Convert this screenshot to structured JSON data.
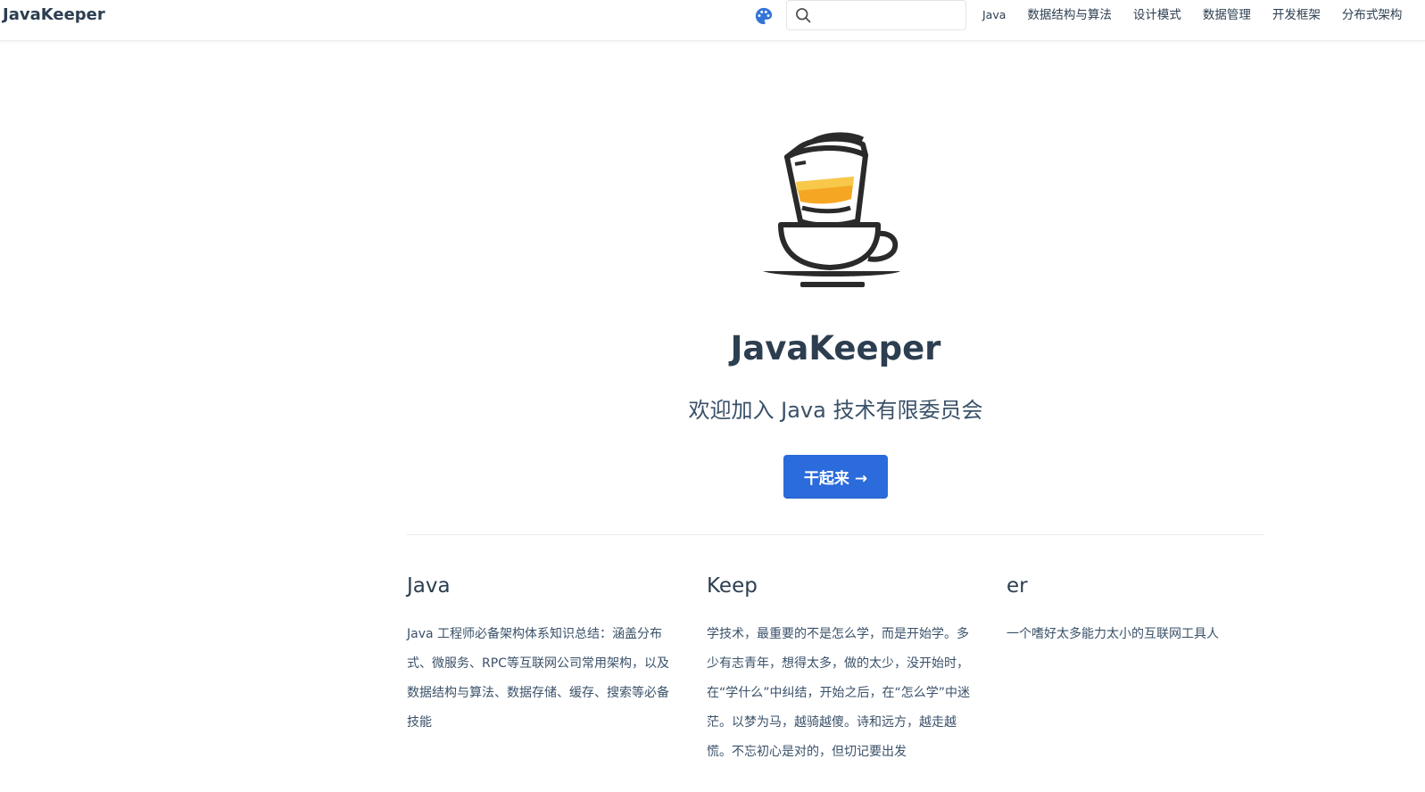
{
  "navbar": {
    "site_name": "JavaKeeper",
    "palette_icon": "palette-icon",
    "search": {
      "placeholder": "",
      "value": "",
      "icon": "search-icon"
    },
    "links": [
      "Java",
      "数据结构与算法",
      "设计模式",
      "数据管理",
      "开发框架",
      "分布式架构"
    ]
  },
  "hero": {
    "logo": "coffee-cup-newspaper-logo",
    "title": "JavaKeeper",
    "description": "欢迎加入 Java 技术有限委员会",
    "action_label": "干起来 →"
  },
  "features": [
    {
      "title": "Java",
      "details": "Java 工程师必备架构体系知识总结：涵盖分布式、微服务、RPC等互联网公司常用架构，以及数据结构与算法、数据存储、缓存、搜索等必备技能"
    },
    {
      "title": "Keep",
      "details": "学技术，最重要的不是怎么学，而是开始学。多少有志青年，想得太多，做的太少，没开始时，在“学什么”中纠结，开始之后，在“怎么学”中迷茫。以梦为马，越骑越傻。诗和远方，越走越慌。不忘初心是对的，但切记要出发"
    },
    {
      "title": "er",
      "details": "一个嗜好太多能力太小的互联网工具人"
    }
  ],
  "colors": {
    "accent": "#2b6bdb",
    "text": "#2c3e50",
    "palette_blue": "#3474d9",
    "cup_orange": "#f5a623"
  }
}
